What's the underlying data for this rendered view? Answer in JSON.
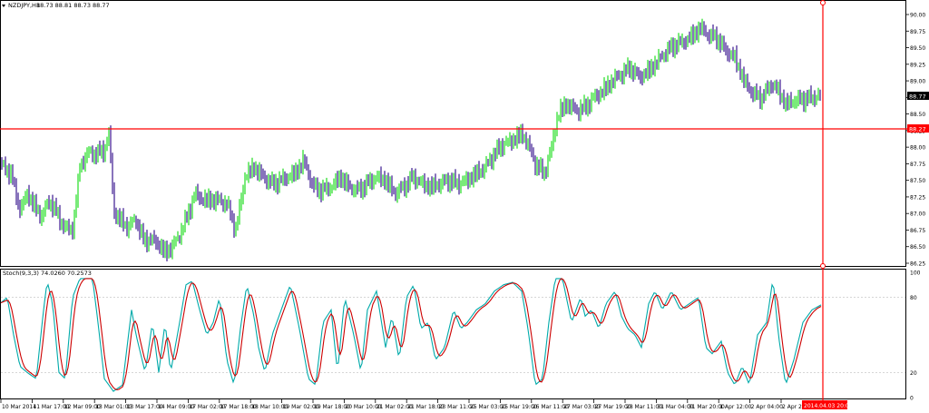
{
  "header": {
    "symbol_label": "NZDJPY,H1",
    "ohlc": "88.73 88.81 88.73 88.77"
  },
  "price_axis": {
    "labels": [
      "90.00",
      "89.75",
      "89.50",
      "89.25",
      "89.00",
      "88.75",
      "88.50",
      "88.25",
      "88.00",
      "87.75",
      "87.50",
      "87.25",
      "87.00",
      "86.75",
      "86.50",
      "86.25"
    ],
    "min": 86.25,
    "max": 90.0
  },
  "current_price": "88.77",
  "hline_price": "88.27",
  "hline_value": 88.27,
  "colors": {
    "bull": "#22dd22",
    "bear": "#3a1890",
    "hline": "#ff0000",
    "main_line": "#00aaaa",
    "signal_line": "#cc0000",
    "grid": "#c8c8c8"
  },
  "indicator": {
    "label": "Stoch(9,3,3) 74.0260 70.2573",
    "levels": [
      "100",
      "80",
      "20",
      "0"
    ]
  },
  "time_axis": {
    "labels": [
      "10 Mar 2014",
      "11 Mar 17:00",
      "12 Mar 09:00",
      "13 Mar 01:00",
      "13 Mar 17:00",
      "14 Mar 09:00",
      "17 Mar 02:00",
      "17 Mar 18:00",
      "18 Mar 10:00",
      "19 Mar 02:00",
      "19 Mar 18:00",
      "20 Mar 10:00",
      "21 Mar 02:00",
      "21 Mar 18:00",
      "23 Mar 11:00",
      "25 Mar 03:00",
      "25 Mar 19:00",
      "26 Mar 11:00",
      "27 Mar 03:00",
      "27 Mar 19:00",
      "28 Mar 11:00",
      "31 Mar 04:00",
      "31 Mar 20:00",
      "1 Apr 12:00",
      "2 Apr 04:00",
      "2 Apr 20:00"
    ],
    "cursor_label": "2014.04.03 20:00"
  },
  "chart_data": {
    "type": "candlestick",
    "x_range": [
      "10 Mar 2014",
      "2014.04.03 20:00"
    ],
    "ylim": [
      86.25,
      90.0
    ],
    "horizontal_line": 88.27,
    "last_price": 88.77,
    "price_path": [
      [
        0,
        87.75
      ],
      [
        12,
        87.6
      ],
      [
        22,
        87.05
      ],
      [
        30,
        87.3
      ],
      [
        45,
        86.95
      ],
      [
        55,
        87.2
      ],
      [
        70,
        86.8
      ],
      [
        80,
        86.75
      ],
      [
        88,
        87.7
      ],
      [
        96,
        87.9
      ],
      [
        105,
        87.9
      ],
      [
        115,
        87.95
      ],
      [
        120,
        88.2
      ],
      [
        126,
        87.0
      ],
      [
        140,
        86.8
      ],
      [
        150,
        86.9
      ],
      [
        158,
        86.6
      ],
      [
        170,
        86.6
      ],
      [
        183,
        86.4
      ],
      [
        195,
        86.6
      ],
      [
        205,
        86.9
      ],
      [
        215,
        87.3
      ],
      [
        225,
        87.2
      ],
      [
        240,
        87.2
      ],
      [
        250,
        87.15
      ],
      [
        260,
        86.75
      ],
      [
        270,
        87.55
      ],
      [
        280,
        87.7
      ],
      [
        290,
        87.55
      ],
      [
        300,
        87.45
      ],
      [
        310,
        87.5
      ],
      [
        325,
        87.6
      ],
      [
        335,
        87.8
      ],
      [
        345,
        87.4
      ],
      [
        355,
        87.35
      ],
      [
        365,
        87.4
      ],
      [
        375,
        87.55
      ],
      [
        385,
        87.4
      ],
      [
        395,
        87.35
      ],
      [
        405,
        87.45
      ],
      [
        415,
        87.55
      ],
      [
        425,
        87.5
      ],
      [
        435,
        87.3
      ],
      [
        445,
        87.4
      ],
      [
        455,
        87.55
      ],
      [
        465,
        87.45
      ],
      [
        475,
        87.4
      ],
      [
        485,
        87.45
      ],
      [
        495,
        87.5
      ],
      [
        505,
        87.45
      ],
      [
        515,
        87.5
      ],
      [
        525,
        87.6
      ],
      [
        535,
        87.7
      ],
      [
        545,
        87.9
      ],
      [
        555,
        88.05
      ],
      [
        565,
        88.1
      ],
      [
        575,
        88.2
      ],
      [
        582,
        88.05
      ],
      [
        590,
        87.75
      ],
      [
        600,
        87.6
      ],
      [
        608,
        88.0
      ],
      [
        615,
        88.5
      ],
      [
        625,
        88.65
      ],
      [
        635,
        88.55
      ],
      [
        645,
        88.6
      ],
      [
        655,
        88.75
      ],
      [
        665,
        88.85
      ],
      [
        675,
        89.0
      ],
      [
        685,
        89.1
      ],
      [
        695,
        89.2
      ],
      [
        705,
        89.05
      ],
      [
        715,
        89.15
      ],
      [
        725,
        89.3
      ],
      [
        735,
        89.45
      ],
      [
        745,
        89.55
      ],
      [
        755,
        89.6
      ],
      [
        765,
        89.7
      ],
      [
        772,
        89.8
      ],
      [
        780,
        89.7
      ],
      [
        790,
        89.65
      ],
      [
        800,
        89.45
      ],
      [
        810,
        89.35
      ],
      [
        820,
        89.0
      ],
      [
        830,
        88.8
      ],
      [
        840,
        88.75
      ],
      [
        850,
        88.95
      ],
      [
        858,
        88.85
      ],
      [
        866,
        88.65
      ],
      [
        875,
        88.7
      ],
      [
        885,
        88.72
      ],
      [
        895,
        88.75
      ],
      [
        905,
        88.77
      ]
    ],
    "stochastic": {
      "params": "9,3,3",
      "main": 74.026,
      "signal": 70.2573,
      "levels": [
        0,
        20,
        80,
        100
      ],
      "main_path": [
        [
          0,
          75
        ],
        [
          8,
          80
        ],
        [
          15,
          50
        ],
        [
          22,
          25
        ],
        [
          30,
          20
        ],
        [
          40,
          15
        ],
        [
          48,
          70
        ],
        [
          52,
          93
        ],
        [
          58,
          75
        ],
        [
          65,
          20
        ],
        [
          72,
          15
        ],
        [
          80,
          80
        ],
        [
          88,
          95
        ],
        [
          95,
          95
        ],
        [
          102,
          95
        ],
        [
          108,
          60
        ],
        [
          115,
          15
        ],
        [
          125,
          5
        ],
        [
          135,
          10
        ],
        [
          145,
          70
        ],
        [
          150,
          50
        ],
        [
          160,
          20
        ],
        [
          168,
          60
        ],
        [
          175,
          20
        ],
        [
          182,
          60
        ],
        [
          188,
          20
        ],
        [
          198,
          60
        ],
        [
          205,
          90
        ],
        [
          212,
          93
        ],
        [
          220,
          70
        ],
        [
          228,
          50
        ],
        [
          235,
          60
        ],
        [
          242,
          80
        ],
        [
          250,
          30
        ],
        [
          258,
          10
        ],
        [
          265,
          55
        ],
        [
          272,
          90
        ],
        [
          280,
          65
        ],
        [
          285,
          40
        ],
        [
          292,
          20
        ],
        [
          300,
          50
        ],
        [
          310,
          70
        ],
        [
          320,
          90
        ],
        [
          330,
          55
        ],
        [
          340,
          15
        ],
        [
          348,
          10
        ],
        [
          356,
          60
        ],
        [
          365,
          70
        ],
        [
          372,
          20
        ],
        [
          380,
          80
        ],
        [
          390,
          50
        ],
        [
          398,
          20
        ],
        [
          405,
          70
        ],
        [
          415,
          85
        ],
        [
          425,
          40
        ],
        [
          432,
          65
        ],
        [
          440,
          30
        ],
        [
          448,
          80
        ],
        [
          456,
          90
        ],
        [
          464,
          55
        ],
        [
          472,
          60
        ],
        [
          480,
          30
        ],
        [
          490,
          40
        ],
        [
          500,
          70
        ],
        [
          508,
          55
        ],
        [
          515,
          60
        ],
        [
          525,
          70
        ],
        [
          535,
          75
        ],
        [
          545,
          85
        ],
        [
          555,
          90
        ],
        [
          565,
          92
        ],
        [
          575,
          85
        ],
        [
          582,
          55
        ],
        [
          590,
          10
        ],
        [
          598,
          15
        ],
        [
          605,
          60
        ],
        [
          612,
          95
        ],
        [
          620,
          95
        ],
        [
          630,
          60
        ],
        [
          640,
          80
        ],
        [
          645,
          65
        ],
        [
          652,
          70
        ],
        [
          660,
          55
        ],
        [
          668,
          75
        ],
        [
          678,
          85
        ],
        [
          685,
          65
        ],
        [
          692,
          55
        ],
        [
          700,
          50
        ],
        [
          707,
          40
        ],
        [
          715,
          75
        ],
        [
          722,
          85
        ],
        [
          730,
          70
        ],
        [
          740,
          85
        ],
        [
          750,
          70
        ],
        [
          760,
          75
        ],
        [
          770,
          80
        ],
        [
          778,
          40
        ],
        [
          785,
          35
        ],
        [
          795,
          45
        ],
        [
          802,
          20
        ],
        [
          810,
          10
        ],
        [
          818,
          25
        ],
        [
          826,
          10
        ],
        [
          835,
          50
        ],
        [
          845,
          60
        ],
        [
          852,
          95
        ],
        [
          858,
          50
        ],
        [
          866,
          10
        ],
        [
          875,
          30
        ],
        [
          885,
          60
        ],
        [
          895,
          70
        ],
        [
          905,
          74
        ]
      ]
    }
  }
}
